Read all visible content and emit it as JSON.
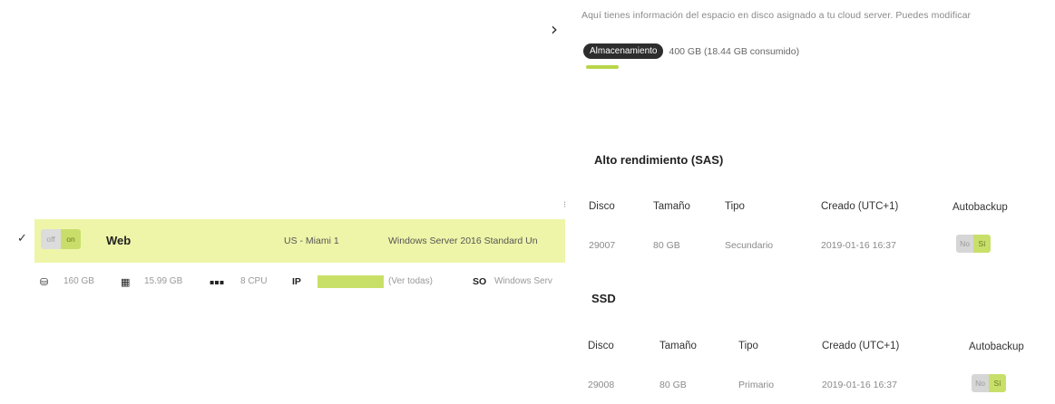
{
  "panel": {
    "info_text": "Aquí tienes información del espacio en disco asignado a tu cloud server. Puedes modificar",
    "storage_label": "Almacenamiento",
    "storage_value": "400 GB (18.44 GB consumido)",
    "storage_used_fraction": 0.046
  },
  "sections": [
    {
      "title": "Alto rendimiento (SAS)",
      "headers": [
        "Disco",
        "Tamaño",
        "Tipo",
        "Creado (UTC+1)",
        "Autobackup"
      ],
      "row": {
        "disk": "29007",
        "size": "80 GB",
        "type": "Secundario",
        "created": "2019-01-16 16:37",
        "toggle_off": "No",
        "toggle_on": "Sí"
      }
    },
    {
      "title": "SSD",
      "headers": [
        "Disco",
        "Tamaño",
        "Tipo",
        "Creado (UTC+1)",
        "Autobackup"
      ],
      "row": {
        "disk": "29008",
        "size": "80 GB",
        "type": "Primario",
        "created": "2019-01-16 16:37",
        "toggle_off": "No",
        "toggle_on": "Sí"
      }
    }
  ],
  "server": {
    "power_off": "off",
    "power_on": "on",
    "name": "Web",
    "location": "US - Miami 1",
    "os": "Windows Server 2016 Standard Un",
    "disk": "160 GB",
    "ram": "15.99 GB",
    "cpu": "8 CPU",
    "ip_label": "IP",
    "ip_link": "(Ver todas)",
    "so_label": "SO",
    "so_value": "Windows Serv"
  }
}
